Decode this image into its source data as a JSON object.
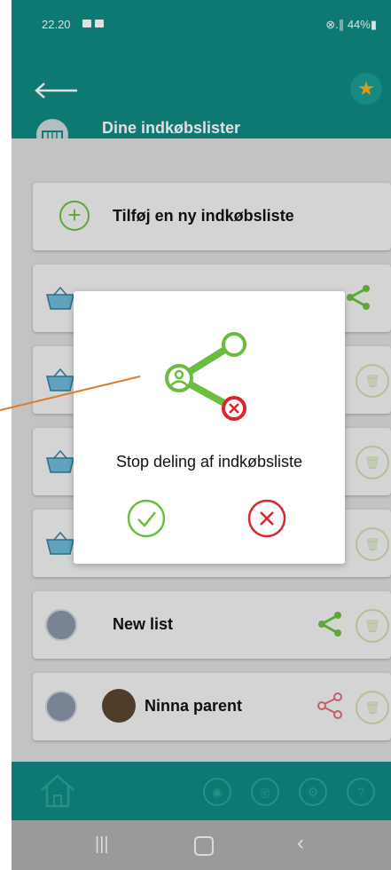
{
  "status_bar": {
    "time": "22.20",
    "right": "⊗.∥ 44%▮"
  },
  "header": {
    "tab_label": "Dine indkøbslister"
  },
  "list": {
    "add_label": "Tilføj en ny indkøbsliste",
    "items": [
      {
        "label": "New list"
      },
      {
        "label": "Ninna parent"
      }
    ]
  },
  "modal": {
    "title": "Stop deling af indkøbsliste",
    "ok_icon": "check-icon",
    "cancel_icon": "close-icon"
  },
  "colors": {
    "teal": "#0f8a82",
    "green": "#6bbd3e",
    "red": "#d9252b",
    "star": "#f6b619"
  }
}
